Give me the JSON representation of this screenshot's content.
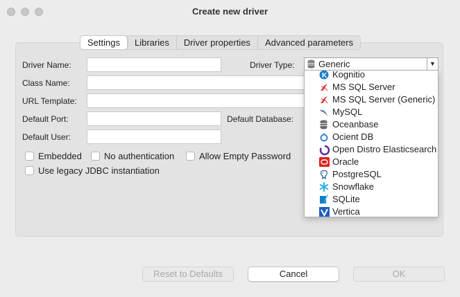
{
  "window": {
    "title": "Create new driver"
  },
  "tabs": [
    "Settings",
    "Libraries",
    "Driver properties",
    "Advanced parameters"
  ],
  "form": {
    "driver_name_label": "Driver Name:",
    "driver_type_label": "Driver Type:",
    "driver_type_value": "Generic",
    "class_name_label": "Class Name:",
    "url_template_label": "URL Template:",
    "default_port_label": "Default Port:",
    "default_database_label": "Default Database:",
    "default_user_label": "Default User:"
  },
  "checkboxes": {
    "embedded": "Embedded",
    "no_auth": "No authentication",
    "allow_empty_password": "Allow Empty Password",
    "legacy_jdbc": "Use legacy JDBC instantiation"
  },
  "dropdown_options": [
    {
      "label": "Kognitio",
      "icon": "kognitio-icon",
      "color": "#1c7fc8"
    },
    {
      "label": "MS SQL Server",
      "icon": "mssql-icon",
      "color": "#d9302c"
    },
    {
      "label": "MS SQL Server (Generic)",
      "icon": "mssql-icon",
      "color": "#d9302c"
    },
    {
      "label": "MySQL",
      "icon": "mysql-icon",
      "color": "#5b87a6"
    },
    {
      "label": "Oceanbase",
      "icon": "database-icon",
      "color": "#666666"
    },
    {
      "label": "Ocient DB",
      "icon": "ocient-icon",
      "color": "#2a7fd4"
    },
    {
      "label": "Open Distro Elasticsearch",
      "icon": "opendistro-icon",
      "color": "#5a2ca0"
    },
    {
      "label": "Oracle",
      "icon": "oracle-icon",
      "color": "#e0201b"
    },
    {
      "label": "PostgreSQL",
      "icon": "postgresql-icon",
      "color": "#336791"
    },
    {
      "label": "Snowflake",
      "icon": "snowflake-icon",
      "color": "#29b5e8"
    },
    {
      "label": "SQLite",
      "icon": "sqlite-icon",
      "color": "#0f80cc"
    },
    {
      "label": "Vertica",
      "icon": "vertica-icon",
      "color": "#1f5fbf"
    }
  ],
  "buttons": {
    "reset": "Reset to Defaults",
    "cancel": "Cancel",
    "ok": "OK"
  }
}
